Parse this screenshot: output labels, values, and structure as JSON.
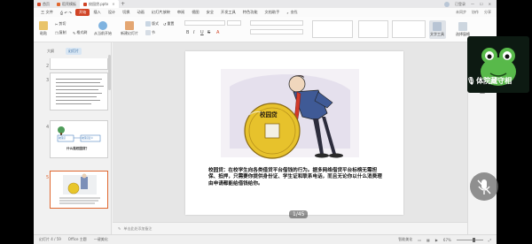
{
  "titlebar": {
    "tabs": [
      {
        "label": "首页",
        "color": "#d04426",
        "active": false
      },
      {
        "label": "稻壳模板",
        "color": "#e0672f",
        "active": false
      },
      {
        "label": "校园贷.pptx",
        "color": "#d04426",
        "active": true
      }
    ],
    "new_tab": "+",
    "user": "已登录"
  },
  "menubar": {
    "file_label": "三 文件",
    "items": [
      "开始",
      "插入",
      "设计",
      "切换",
      "动画",
      "幻灯片放映",
      "审阅",
      "视图",
      "安全",
      "开发工具",
      "特色功能",
      "文档助手"
    ],
    "active": "开始",
    "search_label": "查找",
    "right": [
      "未同步",
      "协作",
      "分享"
    ]
  },
  "ribbon": {
    "cut": "剪切",
    "copy": "复制",
    "format_painter": "格式刷",
    "paste": "粘贴",
    "from_start": "从当前开始",
    "new_slide": "新建幻灯片",
    "layout": "版式",
    "section": "节",
    "reset": "重置",
    "text_tool": "文字工具",
    "selection_pane": "选择窗格",
    "format_buttons": [
      "B",
      "I",
      "U",
      "S",
      "A"
    ]
  },
  "thumbnails": {
    "tabs": [
      "大纲",
      "幻灯片"
    ],
    "active_tab": "幻灯片",
    "slides": [
      {
        "number": "2"
      },
      {
        "number": "3"
      },
      {
        "number": "4",
        "title": "什么是校园贷？",
        "subtitle": "校园贷定义",
        "label": "校园贷"
      }
    ],
    "current": {
      "number": "5"
    }
  },
  "slide": {
    "caption": "校园贷：在校学生向各类借贷平台借钱的行为。据多网络借贷平台标榜无需担保、抵押，只需要你提供身份证、学生证和联系电话，而且无论你以什么消费理由申请都能给借钱给你。",
    "coin_label": "校园贷",
    "page_indicator": "1/45"
  },
  "notes": {
    "placeholder": "单击此处添加备注"
  },
  "statusbar": {
    "slide_info": "幻灯片 4 / 59",
    "theme": "Office 主题",
    "beautify": "一键美化",
    "smart": "智能美化",
    "zoom": "67%"
  },
  "video": {
    "name": "体院藏守相",
    "mic_icon": "mic-off-icon"
  },
  "colors": {
    "accent": "#d04426",
    "current_thumb": "#e0672f",
    "selected_tab": "#3a6ea5"
  }
}
